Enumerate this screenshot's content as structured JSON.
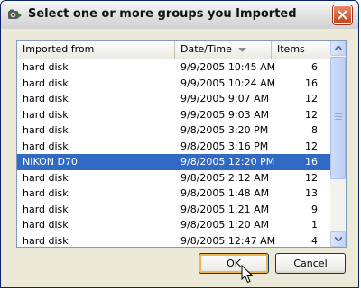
{
  "dialog": {
    "title": "Select one or more groups you Imported",
    "ok_label": "OK",
    "cancel_label": "Cancel"
  },
  "columns": {
    "from": "Imported from",
    "date": "Date/Time",
    "items": "Items"
  },
  "rows": [
    {
      "from": "hard disk",
      "date": "9/9/2005 10:45 AM",
      "items": "6"
    },
    {
      "from": "hard disk",
      "date": "9/9/2005 10:24 AM",
      "items": "16"
    },
    {
      "from": "hard disk",
      "date": "9/9/2005 9:07 AM",
      "items": "12"
    },
    {
      "from": "hard disk",
      "date": "9/9/2005 9:03 AM",
      "items": "12"
    },
    {
      "from": "hard disk",
      "date": "9/8/2005 3:20 PM",
      "items": "8"
    },
    {
      "from": "hard disk",
      "date": "9/8/2005 3:16 PM",
      "items": "12"
    },
    {
      "from": "NIKON D70",
      "date": "9/8/2005 12:20 PM",
      "items": "16"
    },
    {
      "from": "hard disk",
      "date": "9/8/2005 2:12 AM",
      "items": "12"
    },
    {
      "from": "hard disk",
      "date": "9/8/2005 1:48 AM",
      "items": "13"
    },
    {
      "from": "hard disk",
      "date": "9/8/2005 1:21 AM",
      "items": "9"
    },
    {
      "from": "hard disk",
      "date": "9/8/2005 1:20 AM",
      "items": "1"
    },
    {
      "from": "hard disk",
      "date": "9/8/2005 12:47 AM",
      "items": "4"
    }
  ],
  "selected_row": "NIKON D70",
  "colors": {
    "selection": "#316ac5",
    "close_button": "#c5401d",
    "dialog_bg": "#ece9d8"
  },
  "icons": {
    "app": "import-app-icon",
    "close": "close-icon",
    "sort": "sort-descending-icon",
    "cursor": "mouse-pointer-icon"
  }
}
